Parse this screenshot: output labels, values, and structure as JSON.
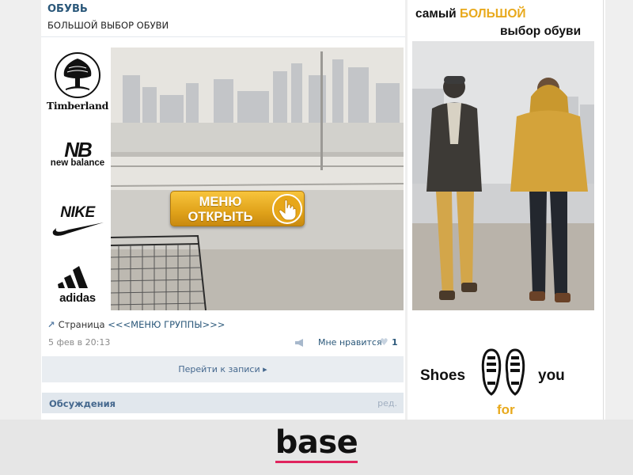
{
  "group": {
    "title": "ОБУВЬ",
    "subtitle": "БОЛЬШОЙ ВЫБОР ОБУВИ"
  },
  "brands": {
    "timberland": "Timberland",
    "new_balance_mark": "NB",
    "new_balance": "new balance",
    "nike": "NIKE",
    "adidas": "adidas"
  },
  "menu_button": {
    "line1": "МЕНЮ",
    "line2": "ОТКРЫТЬ",
    "icon": "pointing-hand-icon"
  },
  "post": {
    "page_prefix": "Страница",
    "page_link": "<<<МЕНЮ ГРУППЫ>>>",
    "date": "5 фев в 20:13",
    "like_label": "Мне нравится",
    "like_count": "1",
    "goto": "Перейти к записи ▸"
  },
  "discussions": {
    "title": "Обсуждения",
    "edit": "ред."
  },
  "promo": {
    "line1_a": "самый ",
    "line1_highlight": "БОЛЬШОЙ",
    "line2": "выбор обуви",
    "shoes": "Shoes",
    "for": "for",
    "you": "you"
  },
  "footer": {
    "logo": "base"
  },
  "colors": {
    "link": "#2b587a",
    "accent": "#e8a91c",
    "footer_underline": "#e0245e"
  }
}
